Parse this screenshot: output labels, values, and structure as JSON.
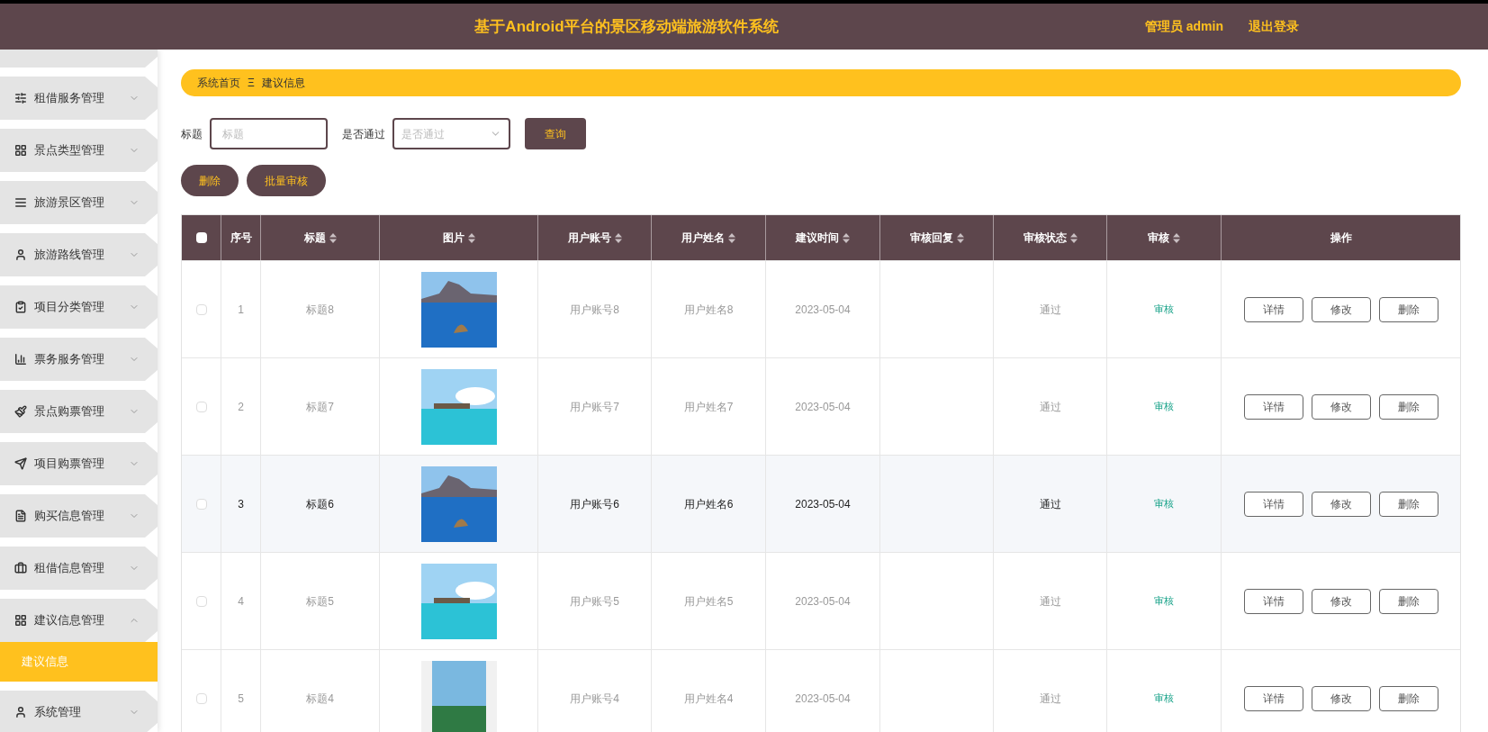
{
  "header": {
    "title": "基于Android平台的景区移动端旅游软件系统",
    "user": "管理员 admin",
    "logout": "退出登录"
  },
  "sidebar": {
    "items": [
      {
        "label": "租借服务管理",
        "expanded": false
      },
      {
        "label": "景点类型管理",
        "expanded": false
      },
      {
        "label": "旅游景区管理",
        "expanded": false
      },
      {
        "label": "旅游路线管理",
        "expanded": false
      },
      {
        "label": "项目分类管理",
        "expanded": false
      },
      {
        "label": "票务服务管理",
        "expanded": false
      },
      {
        "label": "景点购票管理",
        "expanded": false
      },
      {
        "label": "项目购票管理",
        "expanded": false
      },
      {
        "label": "购买信息管理",
        "expanded": false
      },
      {
        "label": "租借信息管理",
        "expanded": false
      },
      {
        "label": "建议信息管理",
        "expanded": true,
        "children": [
          {
            "label": "建议信息",
            "selected": true
          }
        ]
      },
      {
        "label": "系统管理",
        "expanded": false
      }
    ]
  },
  "breadcrumb": {
    "home": "系统首页",
    "separator": "Ξ",
    "current": "建议信息"
  },
  "search": {
    "fields": [
      {
        "label": "标题",
        "placeholder": "标题",
        "kind": "text"
      },
      {
        "label": "是否通过",
        "placeholder": "是否通过",
        "kind": "select"
      }
    ],
    "button": "查询"
  },
  "actions": [
    "删除",
    "批量审核"
  ],
  "table": {
    "columns": [
      {
        "label": "序号",
        "sortable": false
      },
      {
        "label": "标题",
        "sortable": true
      },
      {
        "label": "图片",
        "sortable": true
      },
      {
        "label": "用户账号",
        "sortable": true
      },
      {
        "label": "用户姓名",
        "sortable": true
      },
      {
        "label": "建议时间",
        "sortable": true
      },
      {
        "label": "审核回复",
        "sortable": true
      },
      {
        "label": "审核状态",
        "sortable": true
      },
      {
        "label": "审核",
        "sortable": true
      },
      {
        "label": "操作",
        "sortable": false
      }
    ],
    "all_checked": false,
    "rows": [
      {
        "index": "1",
        "title": "标题8",
        "account": "用户账号8",
        "name": "用户姓名8",
        "time": "2023-05-04",
        "status": "通过",
        "review": "审核",
        "buttons": [
          "详情",
          "修改",
          "删除"
        ],
        "checked": false,
        "highlighted": false
      },
      {
        "index": "2",
        "title": "标题7",
        "account": "用户账号7",
        "name": "用户姓名7",
        "time": "2023-05-04",
        "status": "通过",
        "review": "审核",
        "buttons": [
          "详情",
          "修改",
          "删除"
        ],
        "checked": false,
        "highlighted": false
      },
      {
        "index": "3",
        "title": "标题6",
        "account": "用户账号6",
        "name": "用户姓名6",
        "time": "2023-05-04",
        "status": "通过",
        "review": "审核",
        "buttons": [
          "详情",
          "修改",
          "删除"
        ],
        "checked": false,
        "highlighted": true
      },
      {
        "index": "4",
        "title": "标题5",
        "account": "用户账号5",
        "name": "用户姓名5",
        "time": "2023-05-04",
        "status": "通过",
        "review": "审核",
        "buttons": [
          "详情",
          "修改",
          "删除"
        ],
        "checked": false,
        "highlighted": false
      },
      {
        "index": "5",
        "title": "标题4",
        "account": "用户账号4",
        "name": "用户姓名4",
        "time": "2023-05-04",
        "status": "通过",
        "review": "审核",
        "buttons": [
          "详情",
          "修改",
          "删除"
        ],
        "checked": false,
        "highlighted": false
      }
    ]
  }
}
